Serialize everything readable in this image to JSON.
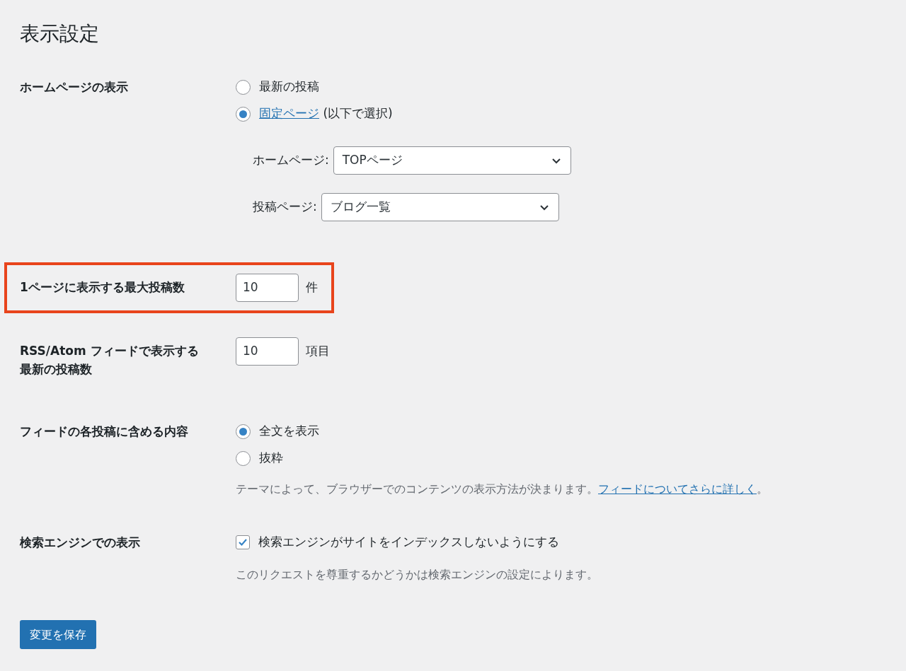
{
  "title": "表示設定",
  "sections": [
    {
      "kind": "radios",
      "label": "ホームページの表示",
      "highlighted": false,
      "options": [
        {
          "text": "最新の投稿",
          "selected": false
        },
        {
          "link": "固定ページ",
          "text": "(以下で選択)",
          "selected": true
        }
      ],
      "selects": [
        {
          "label": "ホームページ:",
          "value": "TOPページ"
        },
        {
          "label": "投稿ページ:",
          "value": "ブログ一覧"
        }
      ]
    },
    {
      "kind": "number",
      "label": "1ページに表示する最大投稿数",
      "highlighted": true,
      "value": "10",
      "suffix": "件"
    },
    {
      "kind": "number",
      "label": [
        "RSS/Atom フィードで表示する",
        "最新の投稿数"
      ],
      "highlighted": false,
      "value": "10",
      "suffix": "項目"
    },
    {
      "kind": "radios",
      "label": "フィードの各投稿に含める内容",
      "highlighted": false,
      "options": [
        {
          "text": "全文を表示",
          "selected": true
        },
        {
          "text": "抜粋",
          "selected": false
        }
      ],
      "description": {
        "text": "テーマによって、ブラウザーでのコンテンツの表示方法が決まります。",
        "link": "フィードについてさらに詳しく",
        "after": "。"
      }
    },
    {
      "kind": "checkbox",
      "label": "検索エンジンでの表示",
      "highlighted": false,
      "checked": true,
      "text": "検索エンジンがサイトをインデックスしないようにする",
      "description": {
        "text": "このリクエストを尊重するかどうかは検索エンジンの設定によります。"
      }
    }
  ],
  "save_button": "変更を保存"
}
